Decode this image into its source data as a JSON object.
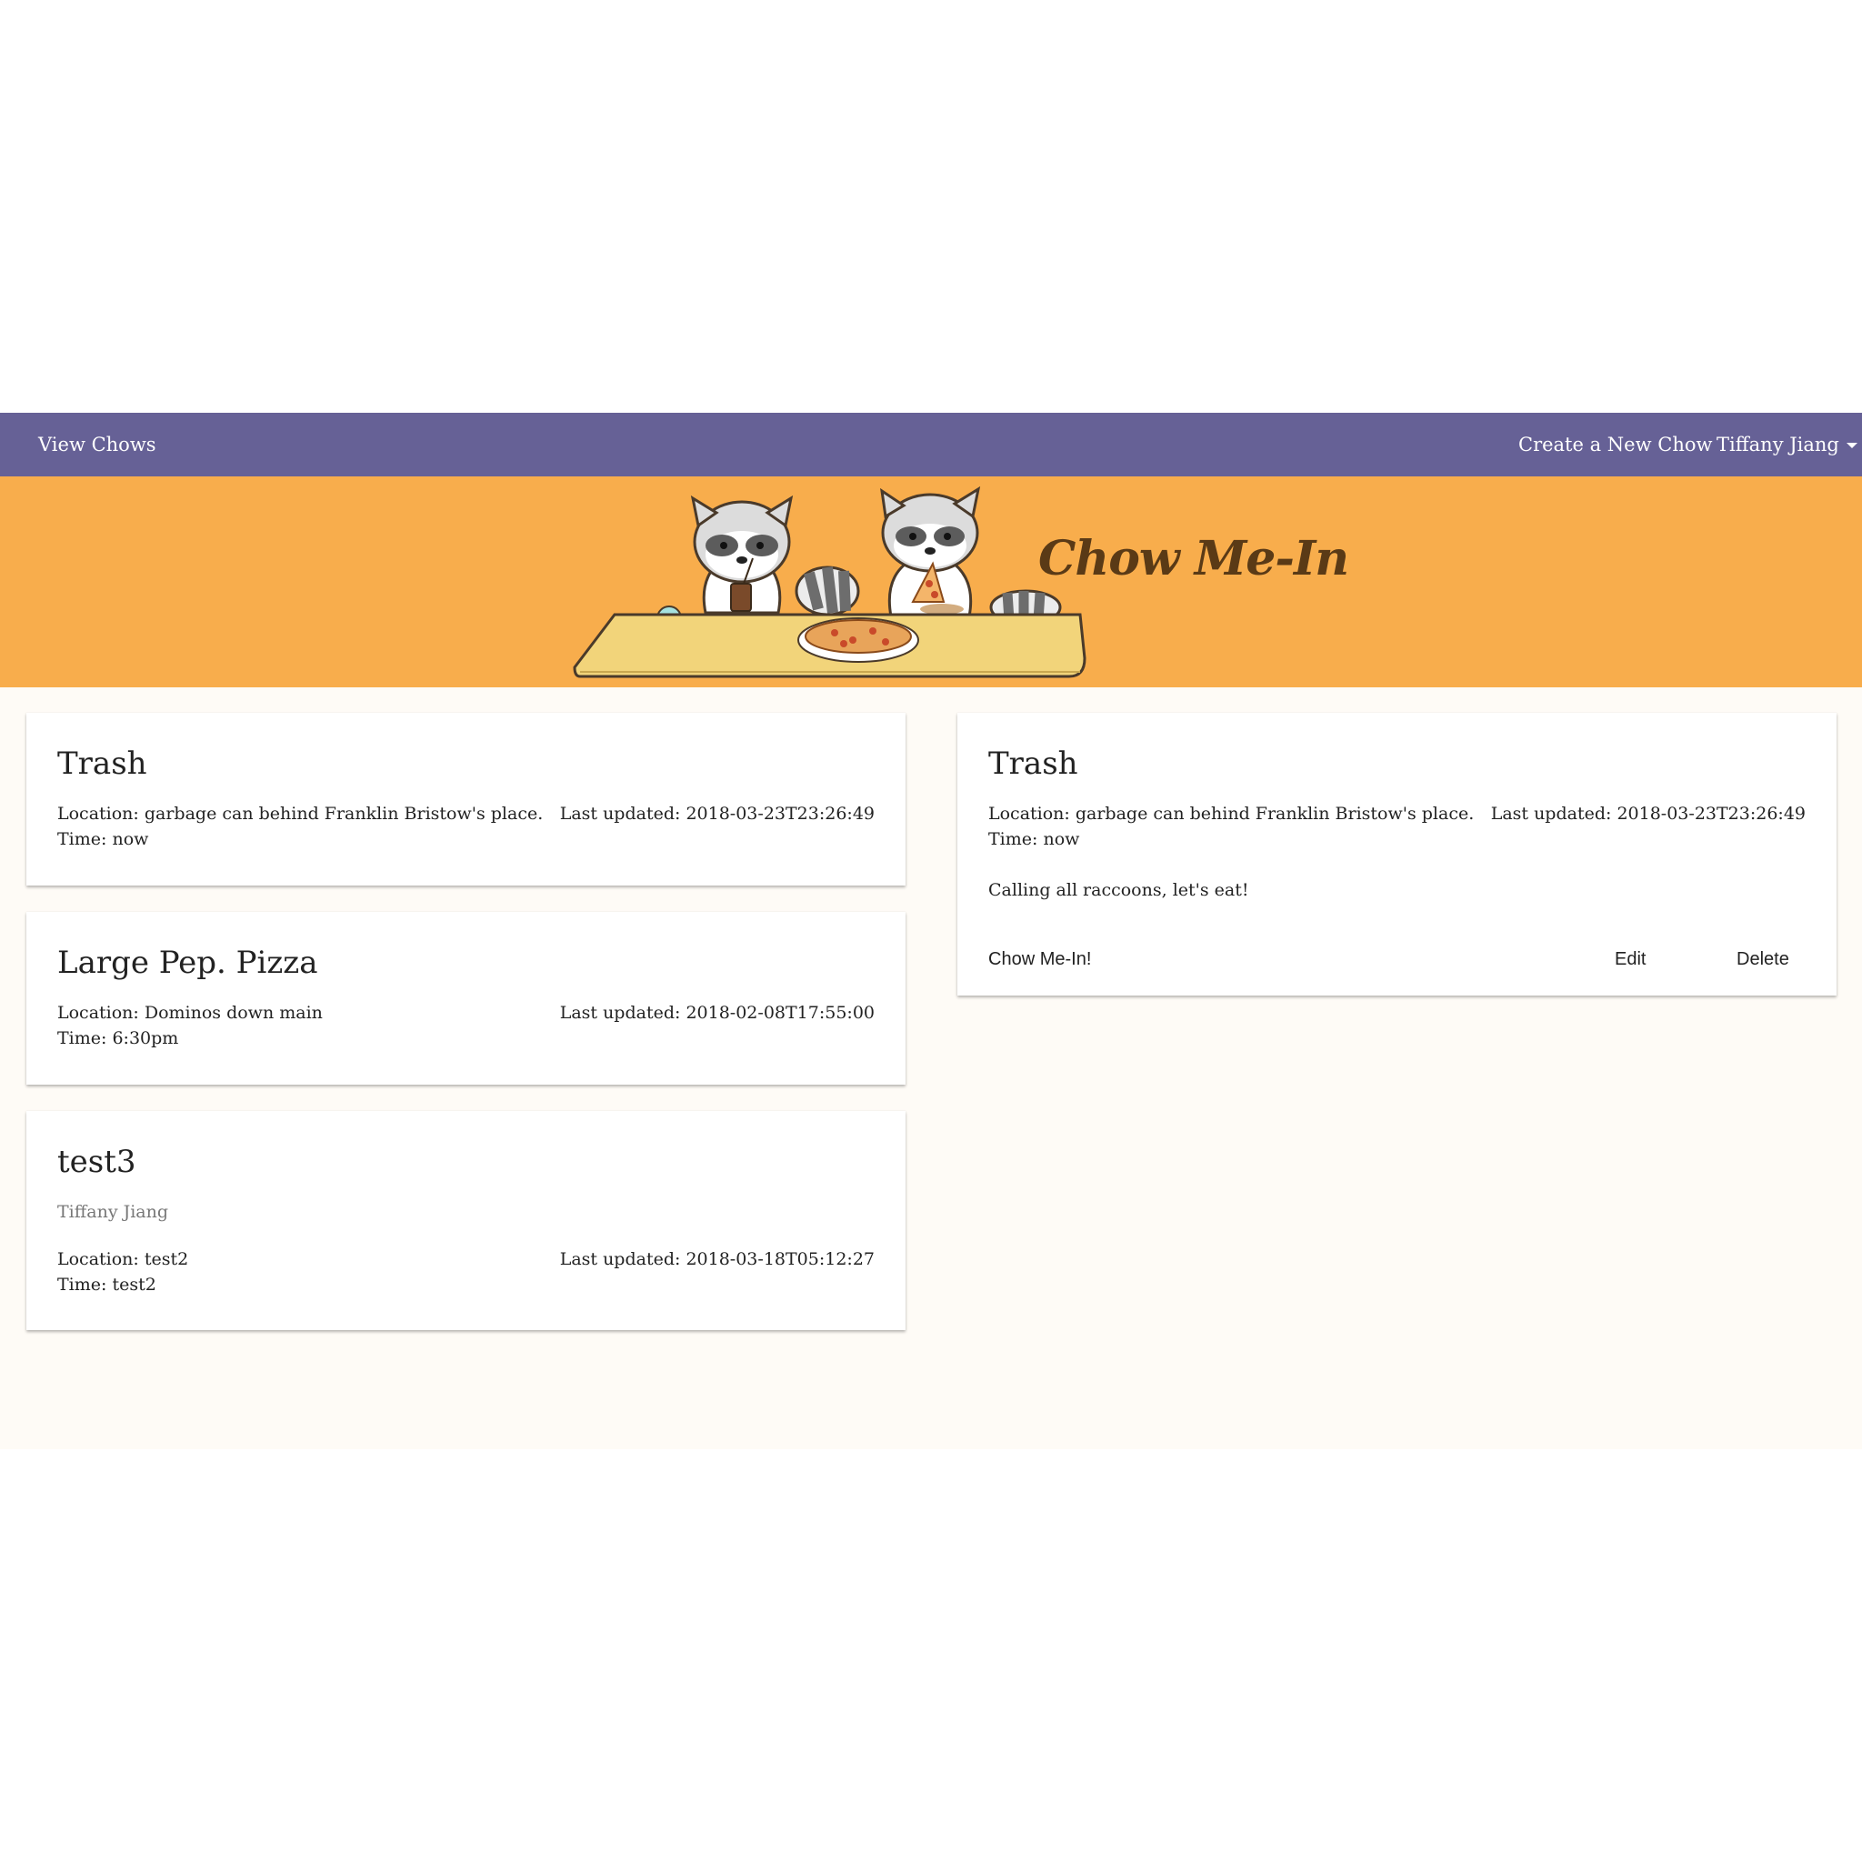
{
  "nav": {
    "view_chows": "View Chows",
    "create_chow": "Create a New Chow",
    "user_name": "Tiffany Jiang"
  },
  "banner": {
    "brand": "Chow Me-In"
  },
  "colors": {
    "navbar": "#666196",
    "banner": "#f8ad4c",
    "page_bg": "#fefbf6",
    "brand_text": "#5a3a16"
  },
  "chow_list": [
    {
      "title": "Trash",
      "location": "Location: garbage can behind Franklin Bristow's place.",
      "time": "Time: now",
      "updated": "Last updated: 2018-03-23T23:26:49"
    },
    {
      "title": "Large Pep. Pizza",
      "location": "Location: Dominos down main",
      "time": "Time: 6:30pm",
      "updated": "Last updated: 2018-02-08T17:55:00"
    },
    {
      "title": "test3",
      "author": "Tiffany Jiang",
      "location": "Location: test2",
      "time": "Time: test2",
      "updated": "Last updated: 2018-03-18T05:12:27"
    }
  ],
  "detail": {
    "title": "Trash",
    "location": "Location: garbage can behind Franklin Bristow's place.",
    "time": "Time: now",
    "updated": "Last updated: 2018-03-23T23:26:49",
    "description": "Calling all raccoons, let's eat!",
    "actions": {
      "join": "Chow Me-In!",
      "edit": "Edit",
      "delete": "Delete"
    }
  }
}
